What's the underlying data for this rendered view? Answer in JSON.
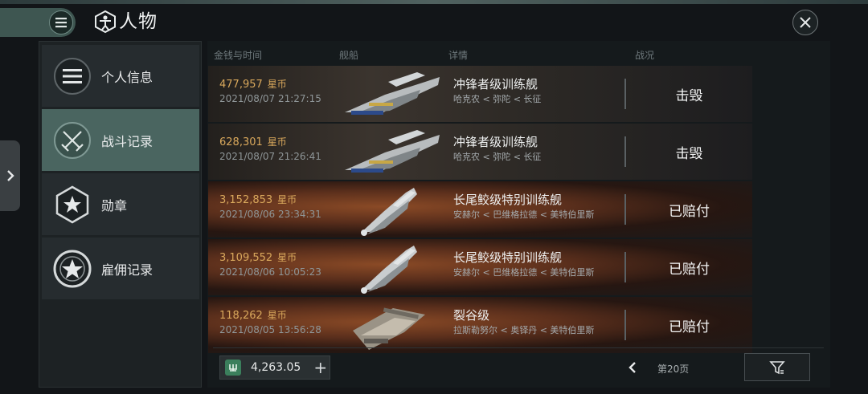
{
  "window": {
    "title": "人物"
  },
  "sidebar": {
    "items": [
      {
        "label": "个人信息",
        "icon": "list-icon",
        "active": false
      },
      {
        "label": "战斗记录",
        "icon": "crossed-swords-icon",
        "active": true
      },
      {
        "label": "勋章",
        "icon": "star-hexagon-icon",
        "active": false
      },
      {
        "label": "雇佣记录",
        "icon": "star-circle-icon",
        "active": false
      }
    ]
  },
  "table": {
    "headers": {
      "money_time": "金钱与时间",
      "ship": "舰船",
      "detail": "详情",
      "status": "战况"
    },
    "currency_unit": "星币",
    "rows": [
      {
        "amount": "477,957",
        "time": "2021/08/07  21:27:15",
        "ship_name": "冲锋者级训练舰",
        "route": "哈克农 < 弥陀 < 长征",
        "status": "击毁"
      },
      {
        "amount": "628,301",
        "time": "2021/08/07  21:26:41",
        "ship_name": "冲锋者级训练舰",
        "route": "哈克农 < 弥陀 < 长征",
        "status": "击毁"
      },
      {
        "amount": "3,152,853",
        "time": "2021/08/06  23:34:31",
        "ship_name": "长尾鲛级特别训练舰",
        "route": "安赫尔 < 巴维格拉德 < 美特伯里斯",
        "status": "已赔付"
      },
      {
        "amount": "3,109,552",
        "time": "2021/08/06  10:05:23",
        "ship_name": "长尾鲛级特别训练舰",
        "route": "安赫尔 < 巴维格拉德 < 美特伯里斯",
        "status": "已赔付"
      },
      {
        "amount": "118,262",
        "time": "2021/08/05  13:56:28",
        "ship_name": "裂谷级",
        "route": "拉斯勒努尔 < 奥铎丹 < 美特伯里斯",
        "status": "已赔付"
      }
    ]
  },
  "footer": {
    "wallet_balance": "4,263.05",
    "plus_label": "+",
    "page_label": "第20页"
  },
  "colors": {
    "accent": "#4a6560",
    "amount": "#d9a85c",
    "wallet_icon": "#3b7f5c"
  }
}
